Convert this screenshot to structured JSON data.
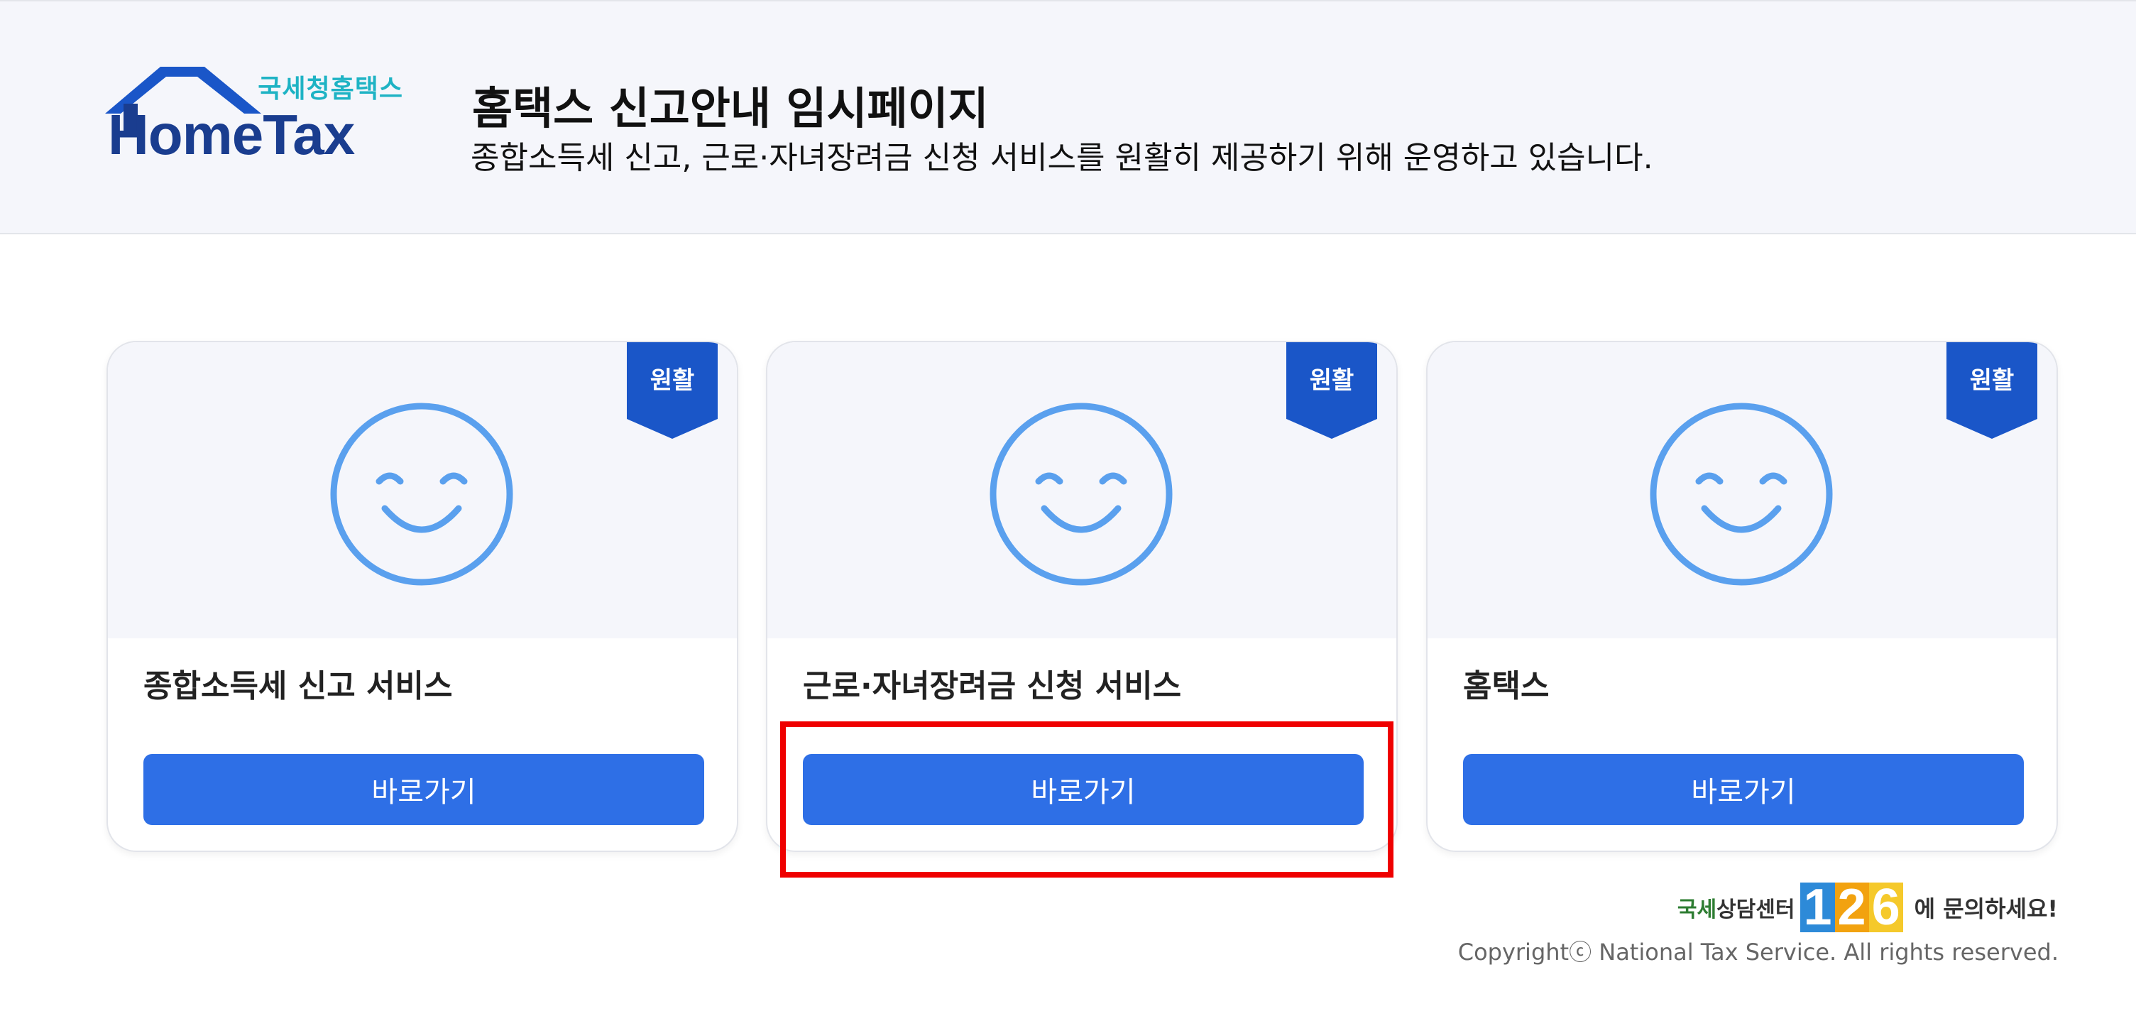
{
  "header": {
    "logo_korean": "국세청홈택스",
    "logo_wordmark": "HomeTax",
    "title": "홈택스 신고안내 임시페이지",
    "subtitle": "종합소득세 신고, 근로·자녀장려금 신청 서비스를 원활히 제공하기 위해 운영하고 있습니다."
  },
  "cards": [
    {
      "status": "원활",
      "title": "종합소득세 신고 서비스",
      "button": "바로가기"
    },
    {
      "status": "원활",
      "title": "근로·자녀장려금 신청 서비스",
      "button": "바로가기"
    },
    {
      "status": "원활",
      "title": "홈택스",
      "button": "바로가기"
    }
  ],
  "footer": {
    "center_prefix_green": "국세",
    "center_prefix_dark": "상담센터",
    "center_number": [
      "1",
      "2",
      "6"
    ],
    "center_suffix": "에 문의하세요!",
    "copyright": "Copyrightⓒ National Tax Service. All rights reserved."
  },
  "colors": {
    "header_bg": "#f5f6fb",
    "primary_button": "#2e6fe6",
    "ribbon": "#1a56c8",
    "smiley": "#5aa0ee",
    "highlight": "#ef0000"
  }
}
